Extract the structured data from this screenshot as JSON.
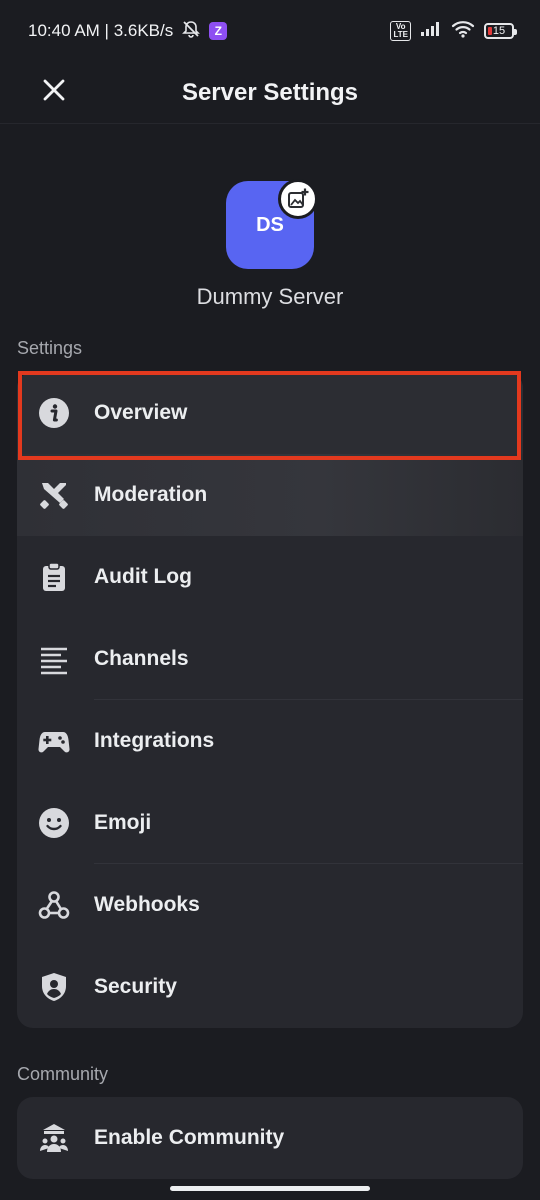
{
  "status_bar": {
    "time_speed": "10:40 AM | 3.6KB/s",
    "z_badge": "Z",
    "volte_top": "Vo",
    "volte_bottom": "LTE",
    "battery": "15"
  },
  "header": {
    "title": "Server Settings",
    "close_icon": "close-icon"
  },
  "server": {
    "initials": "DS",
    "name": "Dummy Server",
    "avatar_color": "#5865f2"
  },
  "settings_section": {
    "label": "Settings",
    "items": [
      {
        "label": "Overview",
        "icon": "info-icon"
      },
      {
        "label": "Moderation",
        "icon": "moderation-icon"
      },
      {
        "label": "Audit Log",
        "icon": "clipboard-icon"
      },
      {
        "label": "Channels",
        "icon": "channels-icon"
      },
      {
        "label": "Integrations",
        "icon": "gamepad-icon"
      },
      {
        "label": "Emoji",
        "icon": "emoji-icon"
      },
      {
        "label": "Webhooks",
        "icon": "webhook-icon"
      },
      {
        "label": "Security",
        "icon": "shield-icon"
      }
    ]
  },
  "community_section": {
    "label": "Community",
    "items": [
      {
        "label": "Enable Community",
        "icon": "community-icon"
      }
    ]
  },
  "colors": {
    "background": "#1b1c21",
    "card": "#27282e",
    "highlight_border": "#e3391e"
  }
}
